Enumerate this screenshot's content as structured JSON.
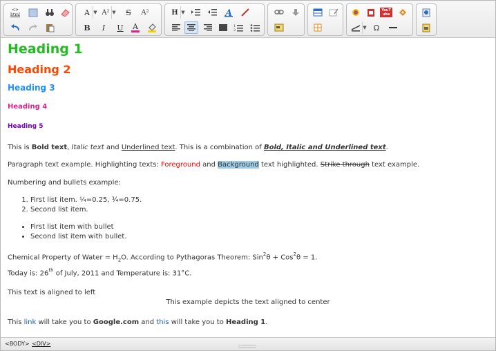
{
  "toolbar": {
    "groups": [
      {
        "name": "edit-group",
        "buttons": [
          "html-source",
          "select-all",
          "find",
          "clear-format",
          "undo",
          "redo",
          "paste"
        ]
      },
      {
        "name": "font-group",
        "buttons": [
          "font-size",
          "font-name",
          "strikethrough",
          "superscript",
          "bold",
          "italic",
          "underline",
          "font-color",
          "highlight"
        ]
      },
      {
        "name": "paragraph-group",
        "buttons": [
          "heading",
          "indent",
          "outdent",
          "styles",
          "brush",
          "align-left",
          "align-center",
          "align-right",
          "justify",
          "ordered-list",
          "unordered-list"
        ]
      },
      {
        "name": "link-group",
        "buttons": [
          "link",
          "anchor",
          "image"
        ]
      },
      {
        "name": "table-group",
        "buttons": [
          "table",
          "form",
          "table-grid"
        ]
      },
      {
        "name": "media-group",
        "buttons": [
          "color-picker",
          "pdf",
          "youtube",
          "flash",
          "horizontal-rule-style",
          "special-char",
          "horizontal-rule"
        ]
      },
      {
        "name": "misc-group",
        "buttons": [
          "preview",
          "print"
        ]
      }
    ],
    "labels": {
      "html": "html",
      "font_size": "A",
      "font_name": "A²",
      "strike": "S",
      "superscript": "A²",
      "bold": "B",
      "italic": "I",
      "underline": "U",
      "font_color": "A",
      "heading": "H",
      "special_char": "Ω",
      "youtube": "YouTube"
    }
  },
  "content": {
    "h1": "Heading 1",
    "h2": "Heading 2",
    "h3": "Heading 3",
    "h4": "Heading 4",
    "h5": "Heading 5",
    "p1": {
      "a": "This is ",
      "bold": "Bold text",
      "b": ", ",
      "italic": "Italic text",
      "c": " and ",
      "underline": "Underlined text",
      "d": ". This is a combination of ",
      "combo": "Bold, Italic and Underlined text",
      "e": "."
    },
    "p2": {
      "a": "Paragraph text example. Highlighting texts: ",
      "fg": "Foreground",
      "b": " and ",
      "bg": "Background",
      "c": " text highlighted. ",
      "strike": "Strike through",
      "d": " text example."
    },
    "p3": "Numbering and bullets example:",
    "ordered": [
      "First list item. ¼=0.25, ¾=0.75.",
      "Second list item."
    ],
    "bullets": [
      "First list item with bullet",
      "Second list item with bullet."
    ],
    "p4": {
      "a": "Chemical Property of Water = H",
      "sub": "2",
      "b": "O. According to Pythagoras Theorem: Sin",
      "sup1": "2",
      "c": "θ + Cos",
      "sup2": "2",
      "d": "θ = 1."
    },
    "p5": {
      "a": "Today is: 26",
      "sup": "th",
      "b": " of July, 2011 and Temperature is: 31°C."
    },
    "p6": "This text is aligned to left",
    "p7": "This example depicts the text aligned to center",
    "p8": {
      "a": "This ",
      "link1": "link",
      "b": " will take you to ",
      "google": "Google.com",
      "c": " and ",
      "link2": "this",
      "d": " will take you to ",
      "heading": "Heading 1",
      "e": "."
    }
  },
  "status": {
    "crumbs": [
      "<BODY>",
      "<DIV>"
    ]
  },
  "colors": {
    "h1": "#22bb22",
    "h2": "#ff4500",
    "h3": "#1e90ff",
    "h4": "#e0218a",
    "h5": "#7a00c8",
    "foreground": "#ff0000",
    "highlight": "#9fcde8",
    "link": "#1a5fb4"
  }
}
